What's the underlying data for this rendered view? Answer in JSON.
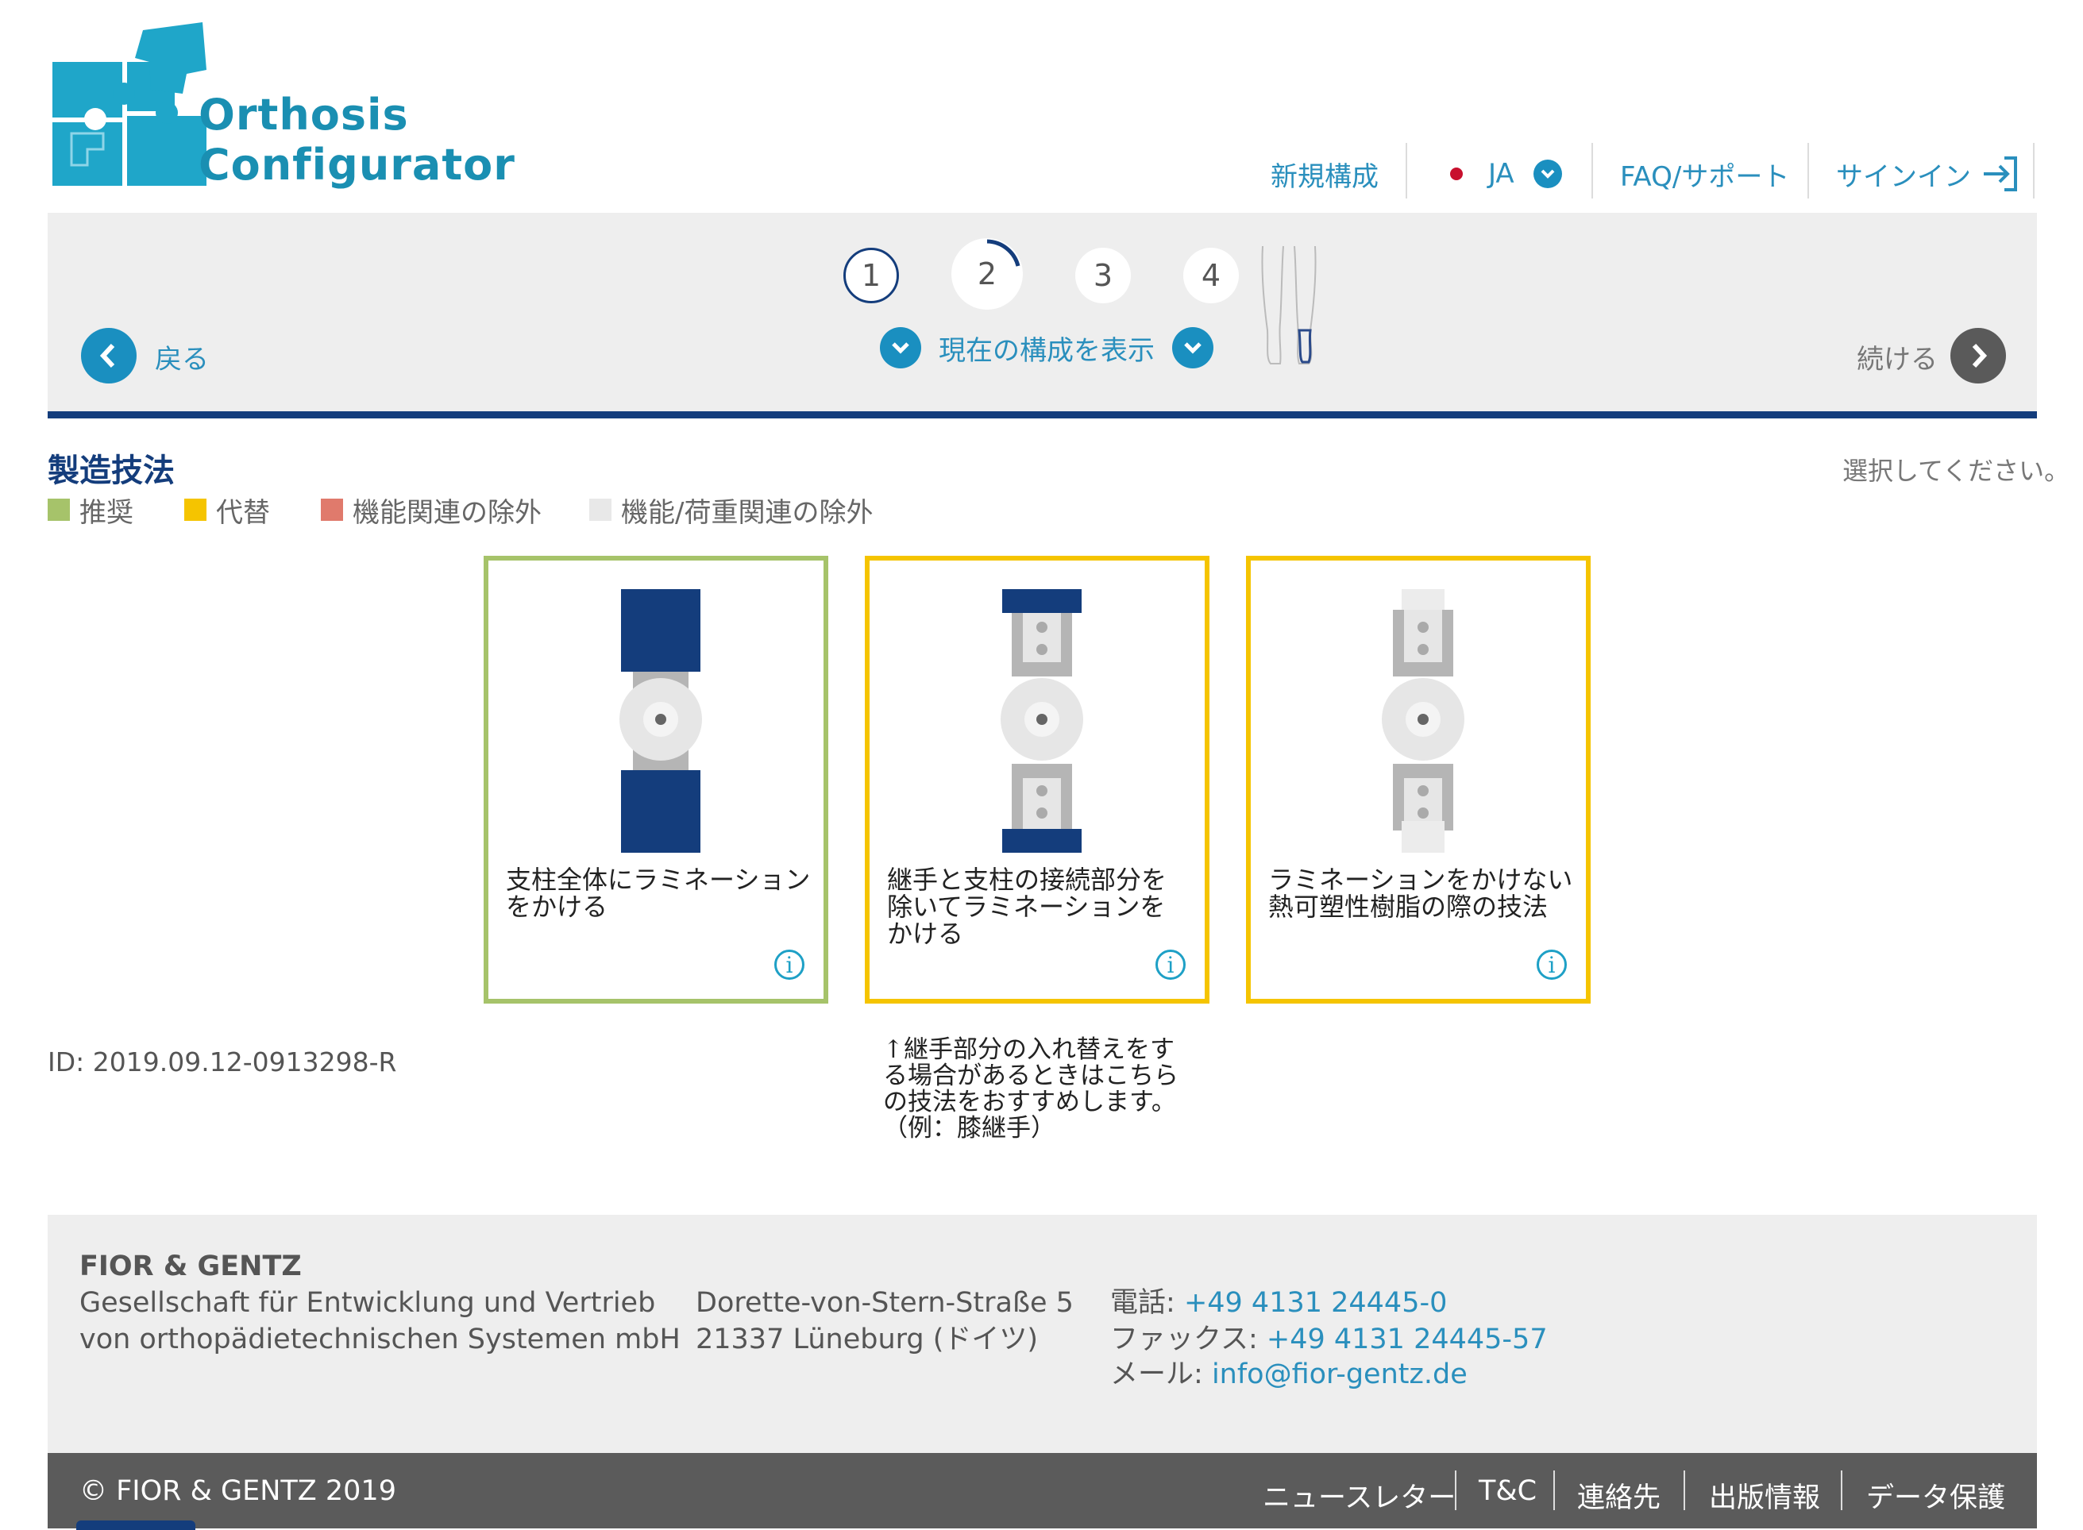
{
  "header": {
    "logo": {
      "line1": "Orthosis",
      "line2": "Configurator"
    },
    "nav": {
      "new_config": "新規構成",
      "language": "JA",
      "faq": "FAQ/サポート",
      "sign_in": "サインイン"
    }
  },
  "stepper": {
    "steps": [
      "1",
      "2",
      "3",
      "4"
    ],
    "current_step": 2,
    "back_label": "戻る",
    "show_config_label": "現在の構成を表示",
    "continue_label": "続ける"
  },
  "section": {
    "title": "製造技法",
    "instruction": "選択してください。"
  },
  "legend": [
    {
      "label": "推奨",
      "color": "#a6c36a"
    },
    {
      "label": "代替",
      "color": "#f5c400"
    },
    {
      "label": "機能関連の除外",
      "color": "#e07a6c"
    },
    {
      "label": "機能/荷重関連の除外",
      "color": "#e8e8e8"
    }
  ],
  "options": [
    {
      "label_line1": "支柱全体にラミネーション",
      "label_line2": "をかける",
      "label_line3": "",
      "border_color": "#a6c36a",
      "icon": "info-icon"
    },
    {
      "label_line1": "継手と支柱の接続部分を",
      "label_line2": "除いてラミネーションを",
      "label_line3": "かける",
      "border_color": "#f5c400",
      "icon": "info-icon"
    },
    {
      "label_line1": "ラミネーションをかけない",
      "label_line2": "熱可塑性樹脂の際の技法",
      "label_line3": "",
      "border_color": "#f5c400",
      "icon": "info-icon"
    }
  ],
  "note": {
    "line1": "↑継手部分の入れ替えをす",
    "line2": "る場合があるときはこちら",
    "line3": "の技法をおすすめします。",
    "line4": "（例：膝継手）"
  },
  "config_id": "ID: 2019.09.12-0913298-R",
  "footer": {
    "company": "FIOR & GENTZ",
    "company_line2": "Gesellschaft für Entwicklung und Vertrieb",
    "company_line3": "von orthopädietechnischen Systemen mbH",
    "street": "Dorette-von-Stern-Straße 5",
    "city": "21337 Lüneburg (ドイツ)",
    "phone_label": "電話:",
    "phone": "+49 4131 24445-0",
    "fax_label": "ファックス:",
    "fax": "+49 4131 24445-57",
    "mail_label": "メール:",
    "mail": "info@fior-gentz.de",
    "copyright": "© FIOR & GENTZ 2019",
    "links": [
      "ニュースレター",
      "T&C",
      "連絡先",
      "出版情報",
      "データ保護"
    ]
  },
  "colors": {
    "brand_navy": "#143d7c",
    "accent_teal": "#1ea0c6",
    "link_blue": "#2a8fbd"
  }
}
